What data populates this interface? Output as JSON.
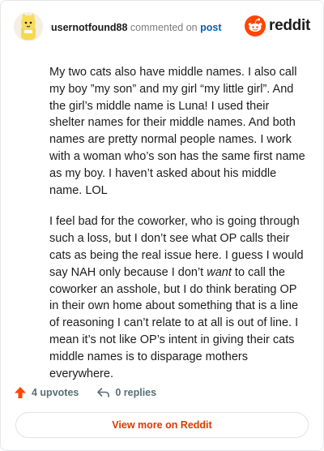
{
  "header": {
    "username": "usernotfound88",
    "commented_text": " commented on ",
    "post_link": "post",
    "brand_wordmark": "reddit",
    "brand_color": "#ff4500"
  },
  "comment": {
    "paragraph_1": "My two cats also have middle names. I also call my boy ”my son” and my girl “my little girl”. And the girl’s middle name is Luna! I used their shelter names for their middle names. And both names are pretty normal people names. I work with a woman who’s son has the same first name as my boy. I haven’t asked about his middle name. LOL",
    "paragraph_2_before_em": "I feel bad for the coworker, who is going through such a loss, but I don’t see what OP calls their cats as being the real issue here. I guess I would say NAH only because I don’t ",
    "paragraph_2_em": "want",
    "paragraph_2_after_em": " to call the coworker an asshole, but I do think berating OP in their own home about something that is a line of reasoning I can’t relate to at all is out of line. I mean it’s not like OP’s intent in giving their cats middle names is to disparage mothers everywhere."
  },
  "actions": {
    "upvotes": "4 upvotes",
    "replies": "0 replies",
    "upvote_icon": "upvote-arrow-icon",
    "reply_icon": "reply-arrow-icon",
    "upvote_color": "#ff4500"
  },
  "footer": {
    "view_more_label": "View more on Reddit",
    "accent_color": "#d93a00"
  }
}
